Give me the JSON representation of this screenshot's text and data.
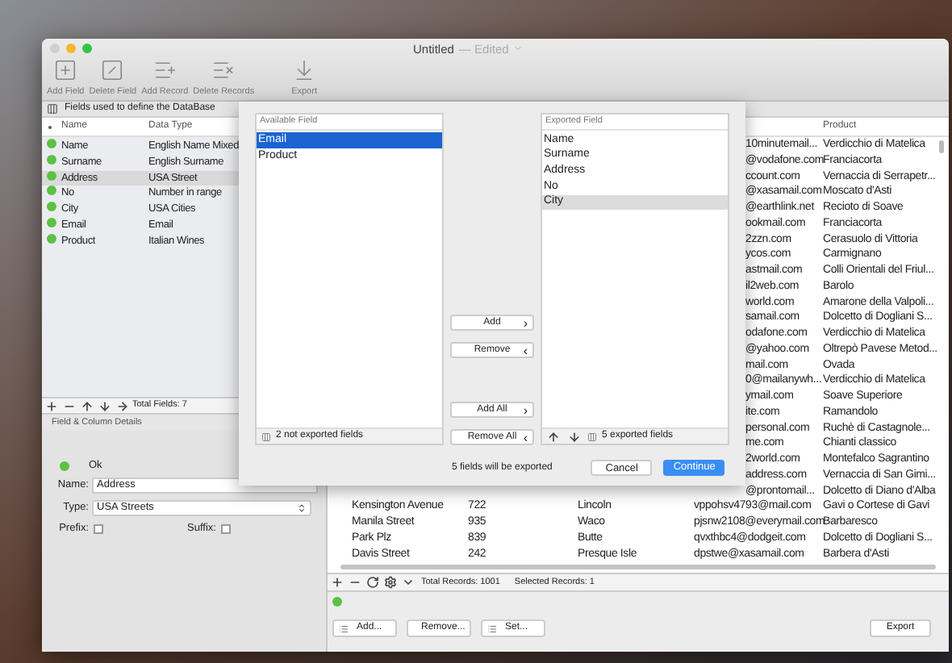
{
  "window": {
    "title": "Untitled",
    "edited": "— Edited"
  },
  "toolbar": [
    {
      "kind": "add-field",
      "label": "Add Field"
    },
    {
      "kind": "delete-field",
      "label": "Delete Field"
    },
    {
      "kind": "add-record",
      "label": "Add Record"
    },
    {
      "kind": "delete-records",
      "label": "Delete Records"
    },
    {
      "kind": "export",
      "label": "Export"
    }
  ],
  "fields_panel": {
    "title": "Fields used to define the DataBase",
    "columns": [
      "Name",
      "Data Type"
    ],
    "rows": [
      {
        "name": "Name",
        "type": "English Name Mixed",
        "valid": true,
        "selected": false
      },
      {
        "name": "Surname",
        "type": "English Surname",
        "valid": true,
        "selected": false
      },
      {
        "name": "Address",
        "type": "USA Street",
        "valid": true,
        "selected": true
      },
      {
        "name": "No",
        "type": "Number in range",
        "valid": true,
        "selected": false
      },
      {
        "name": "City",
        "type": "USA Cities",
        "valid": true,
        "selected": false
      },
      {
        "name": "Email",
        "type": "Email",
        "valid": true,
        "selected": false
      },
      {
        "name": "Product",
        "type": "Italian Wines",
        "valid": true,
        "selected": false
      }
    ],
    "footer": "Total Fields: 7"
  },
  "details": {
    "title": "Field & Column Details",
    "status": "Ok",
    "valid": true,
    "name_label": "Name:",
    "name_value": "Address",
    "type_label": "Type:",
    "type_value": "USA Streets",
    "prefix_label": "Prefix:",
    "prefix_checked": false,
    "suffix_label": "Suffix:",
    "suffix_checked": false
  },
  "records": {
    "columns": [
      "Product"
    ],
    "rows": [
      {
        "kind": "partial",
        "email": "10minutemail...",
        "product": "Verdicchio di Matelica"
      },
      {
        "kind": "partial",
        "email": "@vodafone.com",
        "product": "Franciacorta"
      },
      {
        "kind": "partial",
        "email": "ccount.com",
        "product": "Vernaccia di Serrapetr..."
      },
      {
        "kind": "partial",
        "email": "@xasamail.com",
        "product": "Moscato d'Asti"
      },
      {
        "kind": "partial",
        "email": "@earthlink.net",
        "product": "Recioto di Soave"
      },
      {
        "kind": "partial",
        "email": "ookmail.com",
        "product": "Franciacorta"
      },
      {
        "kind": "partial",
        "email": "2zzn.com",
        "product": "Cerasuolo di Vittoria"
      },
      {
        "kind": "partial",
        "email": "ycos.com",
        "product": "Carmignano"
      },
      {
        "kind": "partial",
        "email": "astmail.com",
        "product": "Colli Orientali del Friul..."
      },
      {
        "kind": "partial",
        "email": "il2web.com",
        "product": "Barolo"
      },
      {
        "kind": "partial",
        "email": "world.com",
        "product": "Amarone della Valpoli..."
      },
      {
        "kind": "partial",
        "email": "samail.com",
        "product": "Dolcetto di Dogliani S..."
      },
      {
        "kind": "partial",
        "email": "odafone.com",
        "product": "Verdicchio di Matelica"
      },
      {
        "kind": "partial",
        "email": "@yahoo.com",
        "product": "Oltrepò Pavese Metod..."
      },
      {
        "kind": "partial",
        "email": "mail.com",
        "product": "Ovada"
      },
      {
        "kind": "partial",
        "email": "0@mailanywh...",
        "product": "Verdicchio di Matelica"
      },
      {
        "kind": "partial",
        "email": "ymail.com",
        "product": "Soave Superiore"
      },
      {
        "kind": "partial",
        "email": "ite.com",
        "product": "Ramandolo"
      },
      {
        "kind": "partial",
        "email": "personal.com",
        "product": "Ruchè di Castagnole..."
      },
      {
        "kind": "partial",
        "email": "me.com",
        "product": "Chianti classico"
      },
      {
        "kind": "partial",
        "email": "2world.com",
        "product": "Montefalco Sagrantino"
      },
      {
        "kind": "partial",
        "email": "address.com",
        "product": "Vernaccia di San Gimi..."
      },
      {
        "kind": "partial",
        "email": "@prontomail...",
        "product": "Dolcetto di Diano d'Alba"
      },
      {
        "kind": "full",
        "address": "Kensington Avenue",
        "number": "722",
        "city": "Lincoln",
        "email": "vppohsv4793@mail.com",
        "product": "Gavi o Cortese di Gavi"
      },
      {
        "kind": "full",
        "address": "Manila Street",
        "number": "935",
        "city": "Waco",
        "email": "pjsnw2108@everymail.com",
        "product": "Barbaresco"
      },
      {
        "kind": "full",
        "address": "Park Plz",
        "number": "839",
        "city": "Butte",
        "email": "qvxthbc4@dodgeit.com",
        "product": "Dolcetto di Dogliani S..."
      },
      {
        "kind": "full",
        "address": "Davis Street",
        "number": "242",
        "city": "Presque Isle",
        "email": "dpstwe@xasamail.com",
        "product": "Barbera d'Asti"
      }
    ],
    "total": "Total Records: 1001",
    "selected": "Selected Records: 1",
    "valid": true,
    "buttons": [
      "Add...",
      "Remove...",
      "Set..."
    ],
    "export_button": "Export"
  },
  "export_sheet": {
    "available_title": "Available Field",
    "available": [
      {
        "label": "Email",
        "selected": true
      },
      {
        "label": "Product",
        "selected": false
      }
    ],
    "available_footer": "2 not exported fields",
    "actions": [
      {
        "label": "Add",
        "chevron": "›"
      },
      {
        "label": "Remove",
        "chevron": "‹"
      },
      {
        "label": "Add All",
        "chevron": "›"
      },
      {
        "label": "Remove All",
        "chevron": "‹"
      }
    ],
    "exported_title": "Exported Field",
    "exported": [
      {
        "label": "Name",
        "selected": false
      },
      {
        "label": "Surname",
        "selected": false
      },
      {
        "label": "Address",
        "selected": false
      },
      {
        "label": "No",
        "selected": false
      },
      {
        "label": "City",
        "selected": true
      }
    ],
    "exported_footer": "5 exported fields",
    "summary": "5 fields will be exported",
    "cancel": "Cancel",
    "continue": "Continue"
  }
}
